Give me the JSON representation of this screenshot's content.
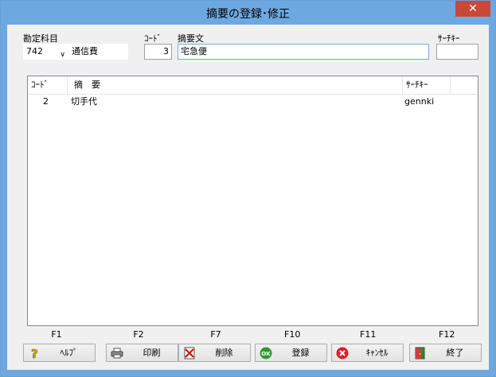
{
  "window": {
    "title": "摘要の登録･修正",
    "close_label": "✕"
  },
  "form": {
    "account_label": "勘定科目",
    "account_code": "742",
    "account_name": "通信費",
    "code_label": "ｺｰﾄﾞ",
    "code_value": "3",
    "summary_label": "摘要文",
    "summary_value": "宅急便",
    "search_key_label": "ｻｰﾁｷｰ",
    "search_key_value": ""
  },
  "list": {
    "columns": [
      "ｺｰﾄﾞ",
      "摘　要",
      "ｻｰﾁｷｰ"
    ],
    "rows": [
      {
        "code": "2",
        "summary": "切手代",
        "search_key": "gennki"
      }
    ]
  },
  "function_keys": [
    {
      "key": "F1",
      "label": "ﾍﾙﾌﾟ",
      "icon": "help-icon"
    },
    {
      "key": "F2",
      "label": "印刷",
      "icon": "printer-icon"
    },
    {
      "key": "F7",
      "label": "削除",
      "icon": "delete-icon"
    },
    {
      "key": "F10",
      "label": "登録",
      "icon": "ok-icon"
    },
    {
      "key": "F11",
      "label": "ｷｬﾝｾﾙ",
      "icon": "cancel-icon"
    },
    {
      "key": "F12",
      "label": "終了",
      "icon": "exit-icon"
    }
  ]
}
